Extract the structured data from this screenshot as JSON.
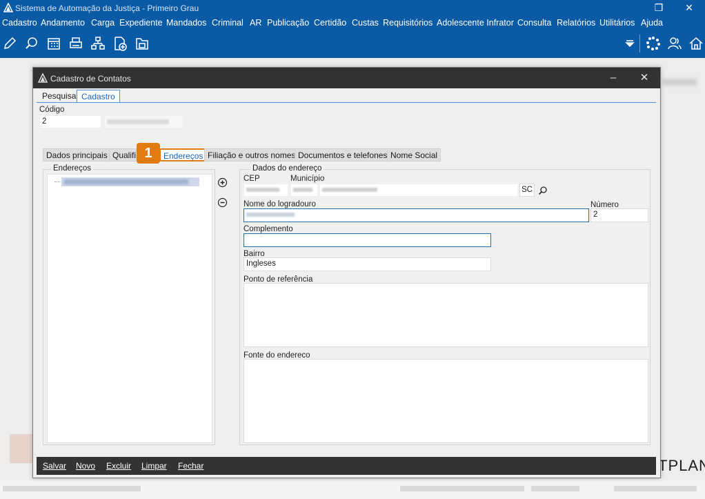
{
  "app": {
    "title": "Sistema de Automação da Justiça - Primeiro Grau",
    "window_buttons": [
      "❐",
      "✕"
    ]
  },
  "menu": [
    "Cadastro",
    "Andamento",
    "Carga",
    "Expediente",
    "Mandados",
    "Criminal",
    "AR",
    "Publicação",
    "Certidão",
    "Custas",
    "Requisitórios",
    "Adolescente Infrator",
    "Consulta",
    "Relatórios",
    "Utilitários",
    "Ajuda"
  ],
  "toolbar_icons": [
    "edit-icon",
    "search-document-icon",
    "calendar-icon",
    "printer-icon",
    "hierarchy-icon",
    "add-document-icon",
    "folder-icon"
  ],
  "toolbar_right_icons": [
    "dropdown-icon",
    "loading-icon",
    "users-icon",
    "home-icon"
  ],
  "dialog": {
    "title": "Cadastro de Contatos",
    "top_tabs": [
      "Pesquisa",
      "Cadastro"
    ],
    "active_top_tab": "Cadastro",
    "codigo_label": "Código",
    "codigo_value": "2",
    "sub_tabs": [
      "Dados principais",
      "Qualific",
      "Endereços",
      "Filiação e outros nomes",
      "Documentos e telefones",
      "Nome Social"
    ],
    "active_sub_tab": "Endereços",
    "step_badge": "1",
    "enderecos_label": "Endereços",
    "dados_endereco_label": "Dados do endereço",
    "cep_label": "CEP",
    "municipio_label": "Município",
    "uf_value": "SC",
    "logradouro_label": "Nome do logradouro",
    "numero_label": "Número",
    "numero_value": "2",
    "complemento_label": "Complemento",
    "complemento_value": "",
    "bairro_label": "Bairro",
    "bairro_value": "Ingleses",
    "ponto_referencia_label": "Ponto de referência",
    "fonte_endereco_label": "Fonte do endereco",
    "bottom_buttons": [
      "Salvar",
      "Novo",
      "Excluir",
      "Limpar",
      "Fechar"
    ]
  },
  "background": {
    "watermark": "TPLAN"
  },
  "colors": {
    "titlebar": "#0a5aa6",
    "dialog_title": "#323232",
    "highlight": "#e07b10",
    "accent": "#1a63b3"
  }
}
